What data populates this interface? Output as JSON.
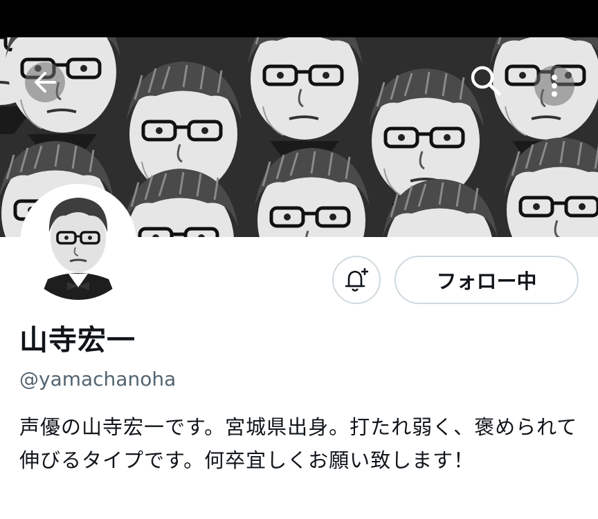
{
  "header": {
    "back_icon": "arrow-left-icon",
    "search_icon": "search-icon",
    "more_icon": "more-vertical-icon"
  },
  "banner": {
    "description_icon": "banner-image"
  },
  "profile": {
    "display_name": "山寺宏一",
    "handle": "@yamachanoha",
    "bio": "声優の山寺宏一です。宮城県出身。打たれ弱く、褒められて伸びるタイプです。何卒宜しくお願い致します！"
  },
  "actions": {
    "bell_icon": "bell-plus-icon",
    "follow_label": "フォロー中"
  },
  "colors": {
    "text_primary": "#0f1419",
    "text_secondary": "#536471",
    "border": "#cfd9de",
    "status_bar": "#000000"
  }
}
